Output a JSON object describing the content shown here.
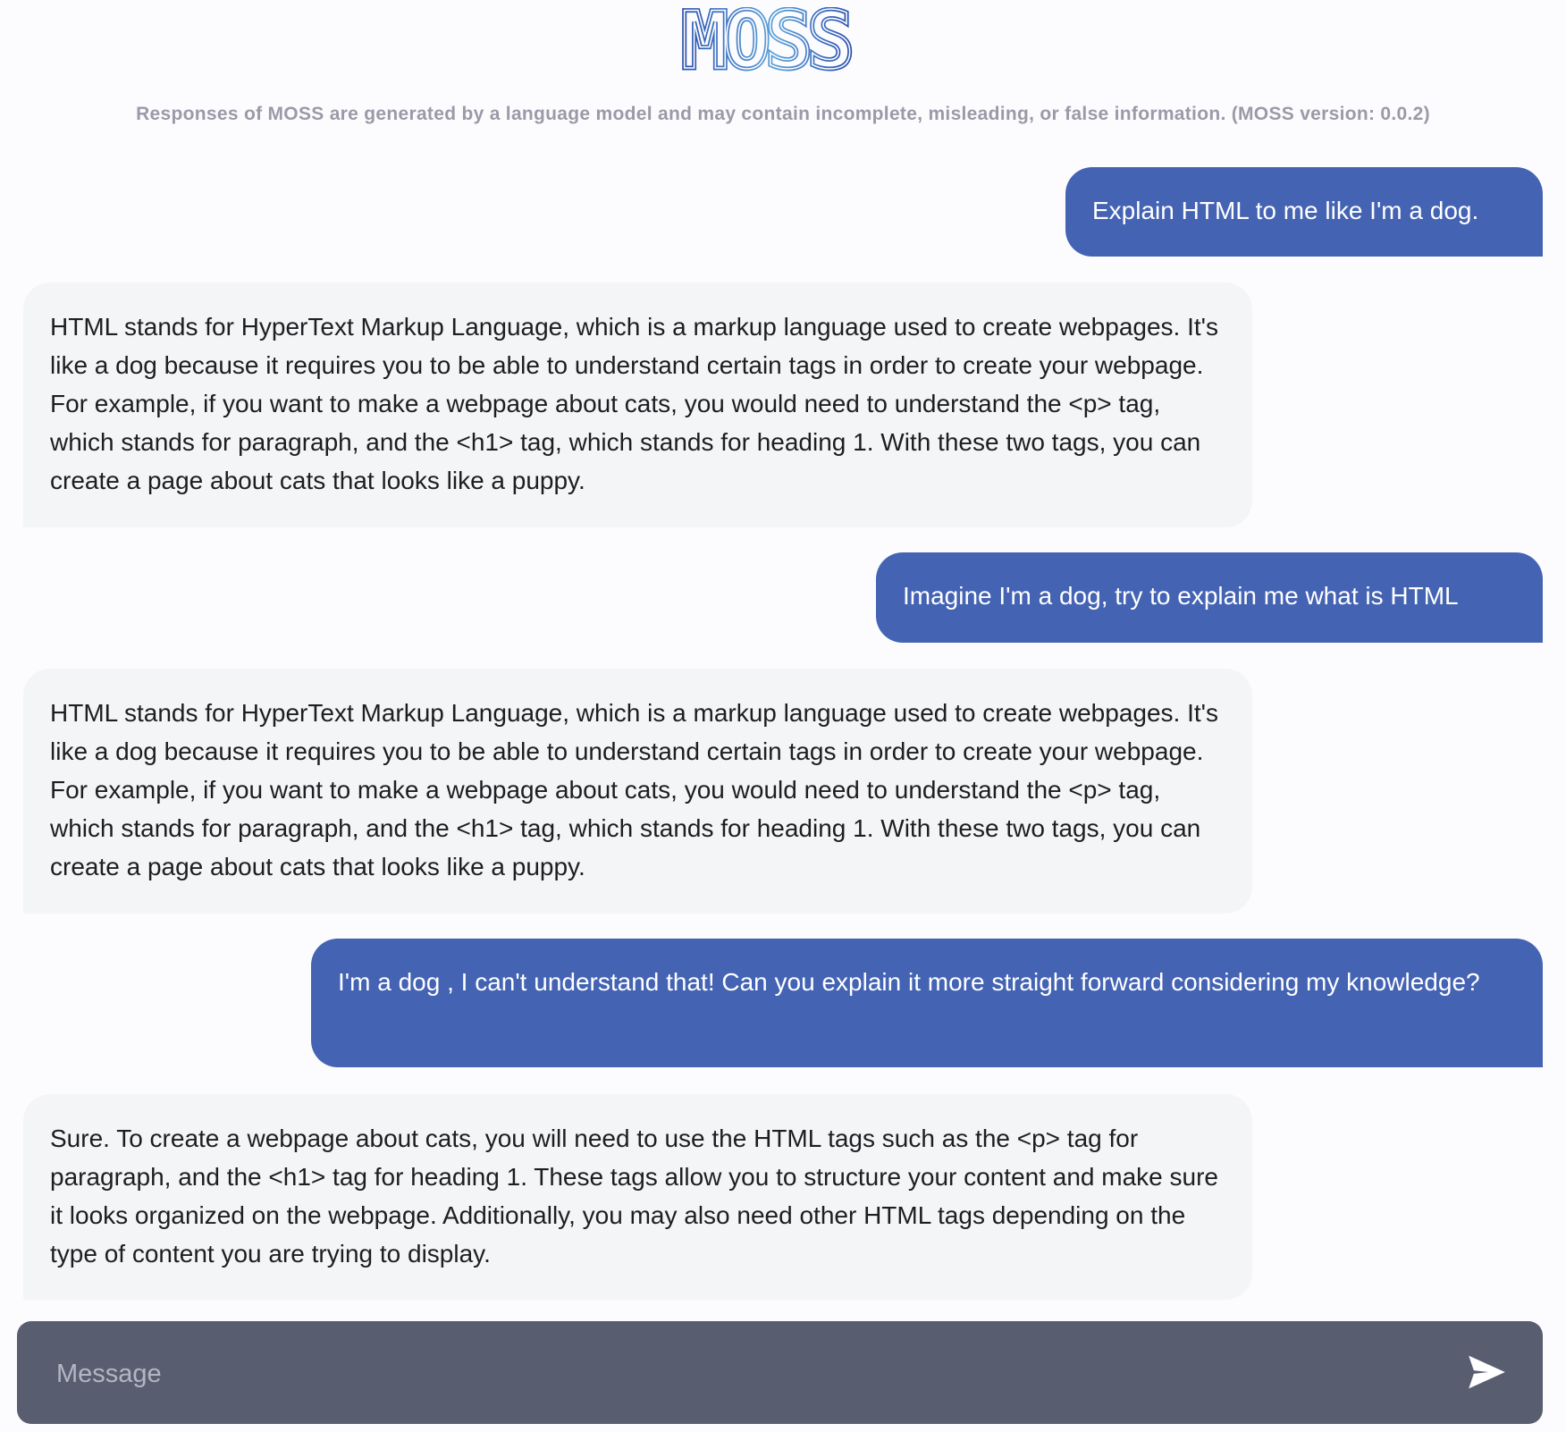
{
  "app": {
    "logo_text": "MOSS",
    "disclaimer": "Responses of MOSS are generated by a language model and may contain incomplete, misleading, or false information. (MOSS version: 0.0.2)"
  },
  "messages": [
    {
      "role": "user",
      "text": "Explain HTML to me like I'm a dog."
    },
    {
      "role": "assistant",
      "text": "HTML stands for HyperText Markup Language, which is a markup language used to create webpages. It's like a dog because it requires you to be able to understand certain tags in order to create your webpage. For example, if you want to make a webpage about cats, you would need to understand the <p> tag, which stands for paragraph, and the <h1> tag, which stands for heading 1. With these two tags, you can create a page about cats that looks like a puppy."
    },
    {
      "role": "user",
      "text": "Imagine I'm a dog, try to explain me what is HTML"
    },
    {
      "role": "assistant",
      "text": "HTML stands for HyperText Markup Language, which is a markup language used to create webpages. It's like a dog because it requires you to be able to understand certain tags in order to create your webpage. For example, if you want to make a webpage about cats, you would need to understand the <p> tag, which stands for paragraph, and the <h1> tag, which stands for heading 1. With these two tags, you can create a page about cats that looks like a puppy."
    },
    {
      "role": "user",
      "text": "I'm a dog , I can't understand that! Can you explain it more straight forward considering my knowledge?"
    },
    {
      "role": "assistant",
      "text": "Sure. To create a webpage about cats, you will need to use the HTML tags such as the <p> tag for paragraph, and the <h1> tag for heading 1. These tags allow you to structure your content and make sure it looks organized on the webpage. Additionally, you may also need other HTML tags depending on the type of content you are trying to display."
    }
  ],
  "composer": {
    "placeholder": "Message",
    "value": "",
    "send_icon": "send-icon"
  },
  "colors": {
    "user_bubble": "#4463b3",
    "assistant_bubble": "#f4f5f6",
    "composer_bg": "#585e70",
    "logo_dark": "#2a4fae",
    "logo_light": "#5aa0d8"
  }
}
